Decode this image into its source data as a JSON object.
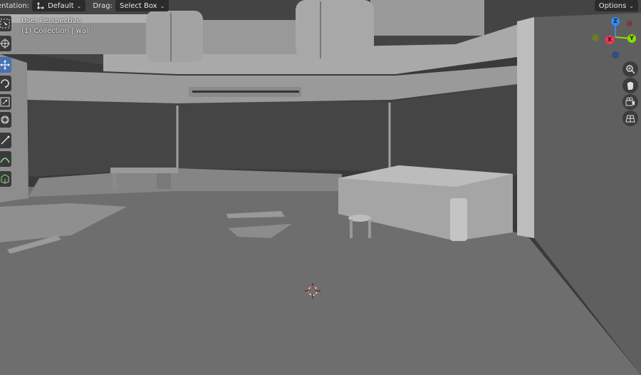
{
  "header": {
    "orientation_label": "entation:",
    "orientation_value": "Default",
    "drag_label": "Drag:",
    "drag_value": "Select Box",
    "options_label": "Options"
  },
  "viewport_overlay": {
    "view_name": "User Perspective",
    "collection_text": "(1) Collection | wall"
  },
  "navigation_gizmo": {
    "axes": [
      "Z",
      "X",
      "Y"
    ],
    "colors": {
      "x": "#ff3352",
      "y": "#8bdc00",
      "z": "#2c8fff"
    }
  },
  "toolbar": {
    "tools": [
      "select-box-icon",
      "cursor-icon",
      "move-icon",
      "rotate-icon",
      "scale-icon",
      "transform-icon",
      "annotate-icon",
      "measure-icon",
      "add-cube-icon"
    ],
    "active_tool": "move-icon"
  },
  "nav_buttons": [
    "zoom-icon",
    "pan-hand-icon",
    "camera-icon",
    "grid-icon"
  ],
  "colors": {
    "active": "#4772b3",
    "background": "#303030",
    "floor": "#6b6b6b"
  }
}
